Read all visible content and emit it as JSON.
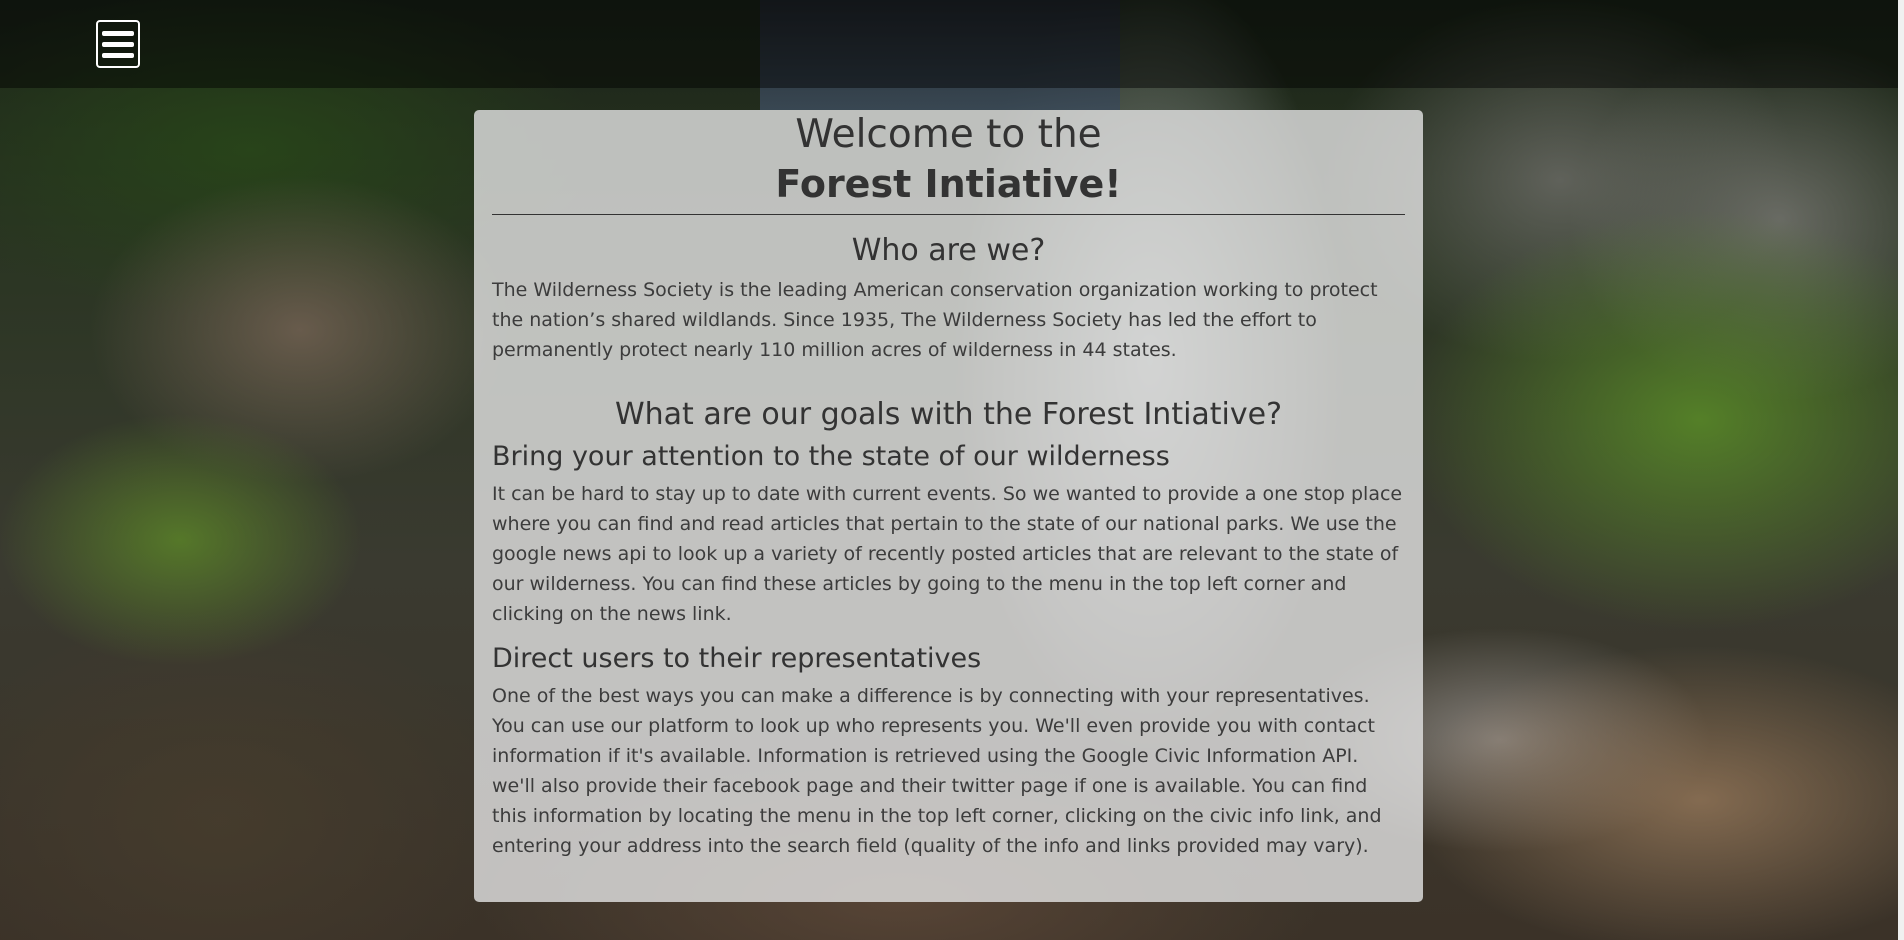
{
  "nav": {
    "menu_label": "Menu"
  },
  "header": {
    "title_line1": "Welcome to the",
    "title_line2": "Forest Intiative!"
  },
  "about": {
    "heading": "Who are we?",
    "body": "The Wilderness Society is the leading American conservation organization working to protect the nation’s shared wildlands. Since 1935, The Wilderness Society has led the effort to permanently protect nearly 110 million acres of wilderness in 44 states."
  },
  "goals": {
    "heading": "What are our goals with the Forest Intiative?",
    "items": [
      {
        "heading": "Bring your attention to the state of our wilderness",
        "body": "It can be hard to stay up to date with current events. So we wanted to provide a one stop place where you can find and read articles that pertain to the state of our national parks. We use the google news api to look up a variety of recently posted articles that are relevant to the state of our wilderness. You can find these articles by going to the menu in the top left corner and clicking on the news link."
      },
      {
        "heading": "Direct users to their representatives",
        "body": "One of the best ways you can make a difference is by connecting with your representatives. You can use our platform to look up who represents you. We'll even provide you with contact information if it's available. Information is retrieved using the Google Civic Information API. we'll also provide their facebook page and their twitter page if one is available. You can find this information by locating the menu in the top left corner, clicking on the civic info link, and entering your address into the search field (quality of the info and links provided may vary)."
      }
    ]
  },
  "colors": {
    "card_bg": "#e1e1e1",
    "text": "#3c3c3c",
    "nav_overlay": "#000000",
    "menu_icon": "#ffffff"
  }
}
